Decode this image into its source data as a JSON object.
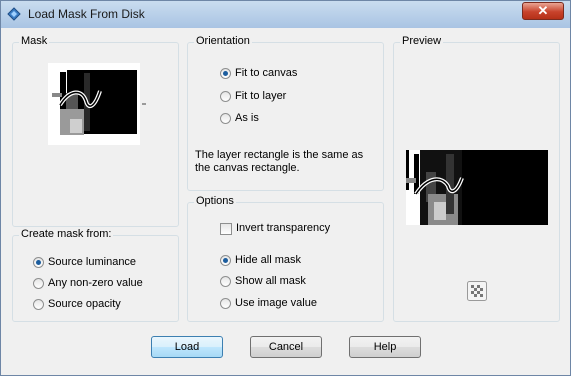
{
  "window": {
    "title": "Load Mask From Disk",
    "close_glyph": "✕"
  },
  "mask": {
    "group_label": "Mask"
  },
  "create_mask": {
    "group_label": "Create mask from:",
    "options": [
      {
        "label": "Source luminance",
        "checked": true
      },
      {
        "label": "Any non-zero value",
        "checked": false
      },
      {
        "label": "Source opacity",
        "checked": false
      }
    ]
  },
  "orientation": {
    "group_label": "Orientation",
    "options": [
      {
        "label": "Fit to canvas",
        "checked": true
      },
      {
        "label": "Fit to layer",
        "checked": false
      },
      {
        "label": "As is",
        "checked": false
      }
    ],
    "note": "The layer rectangle is the same as the canvas rectangle."
  },
  "options": {
    "group_label": "Options",
    "invert_label": "Invert transparency",
    "invert_checked": false,
    "radios": [
      {
        "label": "Hide all mask",
        "checked": true
      },
      {
        "label": "Show all mask",
        "checked": false
      },
      {
        "label": "Use image value",
        "checked": false
      }
    ]
  },
  "preview": {
    "group_label": "Preview",
    "icon": "transparency-checker-icon"
  },
  "buttons": {
    "load": "Load",
    "cancel": "Cancel",
    "help": "Help"
  }
}
